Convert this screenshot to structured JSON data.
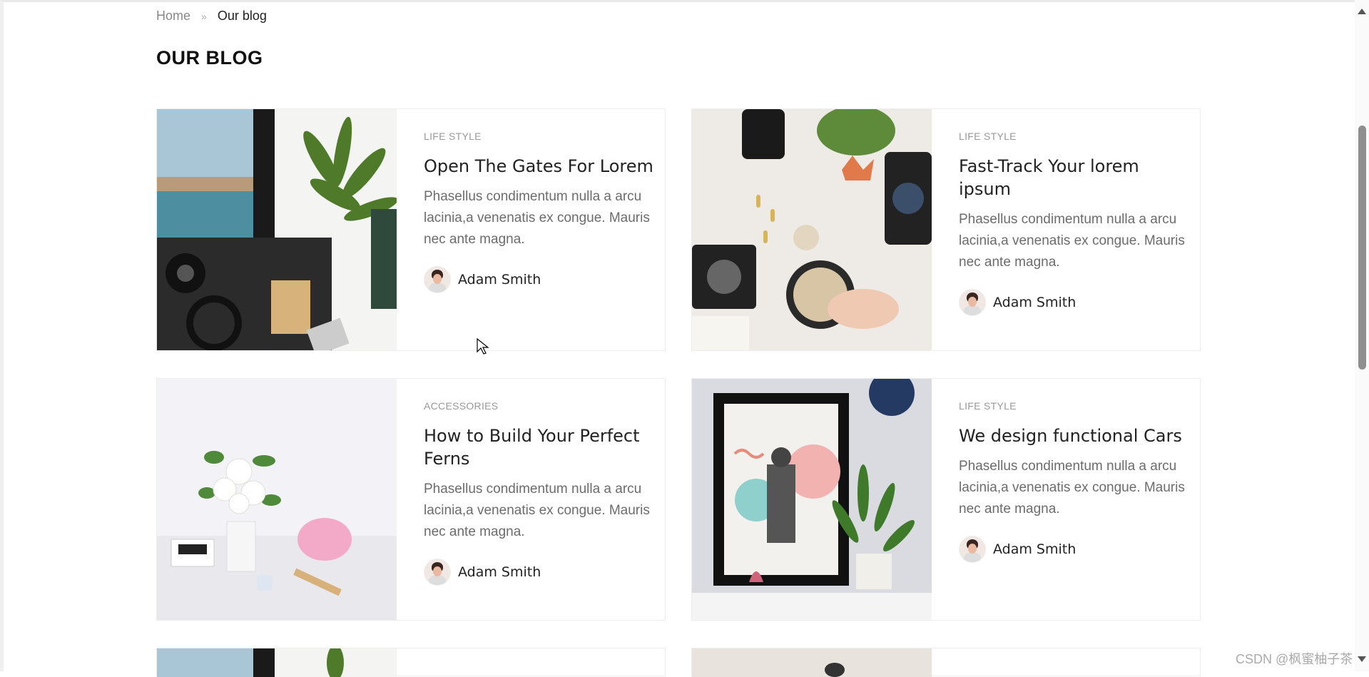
{
  "breadcrumb": {
    "home": "Home",
    "current": "Our blog"
  },
  "page_title": "OUR BLOG",
  "posts": [
    {
      "category": "LIFE STYLE",
      "title": "Open The Gates For Lorem",
      "excerpt": "Phasellus condimentum nulla a arcu lacinia,a venenatis ex congue. Mauris nec ante magna.",
      "author": "Adam Smith"
    },
    {
      "category": "LIFE STYLE",
      "title": "Fast-Track Your lorem ipsum",
      "excerpt": "Phasellus condimentum nulla a arcu lacinia,a venenatis ex congue. Mauris nec ante magna.",
      "author": "Adam Smith"
    },
    {
      "category": "ACCESSORIES",
      "title": "How to Build Your Perfect Ferns",
      "excerpt": "Phasellus condimentum nulla a arcu lacinia,a venenatis ex congue. Mauris nec ante magna.",
      "author": "Adam Smith"
    },
    {
      "category": "LIFE STYLE",
      "title": "We design functional Cars",
      "excerpt": "Phasellus condimentum nulla a arcu lacinia,a venenatis ex congue. Mauris nec ante magna.",
      "author": "Adam Smith"
    }
  ],
  "watermark": "CSDN @枫蜜柚子茶",
  "colors": {
    "text_dark": "#222222",
    "text_muted": "#6c6c6c",
    "category": "#999999",
    "border": "#eeeeee"
  }
}
